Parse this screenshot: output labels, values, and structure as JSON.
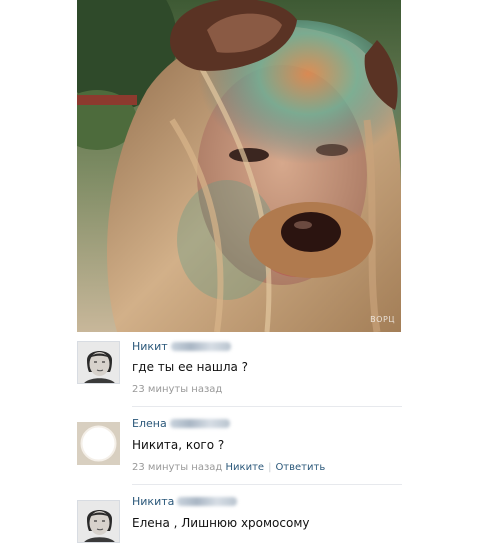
{
  "photo": {
    "watermark": "ВОРЦ",
    "mask": "dog-ears-and-nose-filter",
    "colors": {
      "hair": "#b08a62",
      "skin": "#c99a80",
      "paint_green": "#7fb89a",
      "paint_orange": "#d7834a",
      "ears": "#5a3324",
      "nose": "#2b1410",
      "background": "#6d7a5c"
    }
  },
  "comments": [
    {
      "author": "Никит",
      "text": "где ты ее нашла ?",
      "time": "23 минуты назад",
      "avatar": "male-face-sketch-avatar"
    },
    {
      "author": "Елена",
      "text": "Никита, кого ?",
      "time": "23 минуты назад",
      "reply_to": "Никите",
      "reply_label": "Ответить",
      "avatar": "hidden-blank-avatar"
    },
    {
      "author": "Никита",
      "text": "Елена , Лишнюю хромосому",
      "avatar": "male-face-sketch-avatar"
    }
  ],
  "colors": {
    "link": "#2b587a",
    "meta": "#999999",
    "text": "#111111",
    "divider": "#e7e9ed"
  }
}
